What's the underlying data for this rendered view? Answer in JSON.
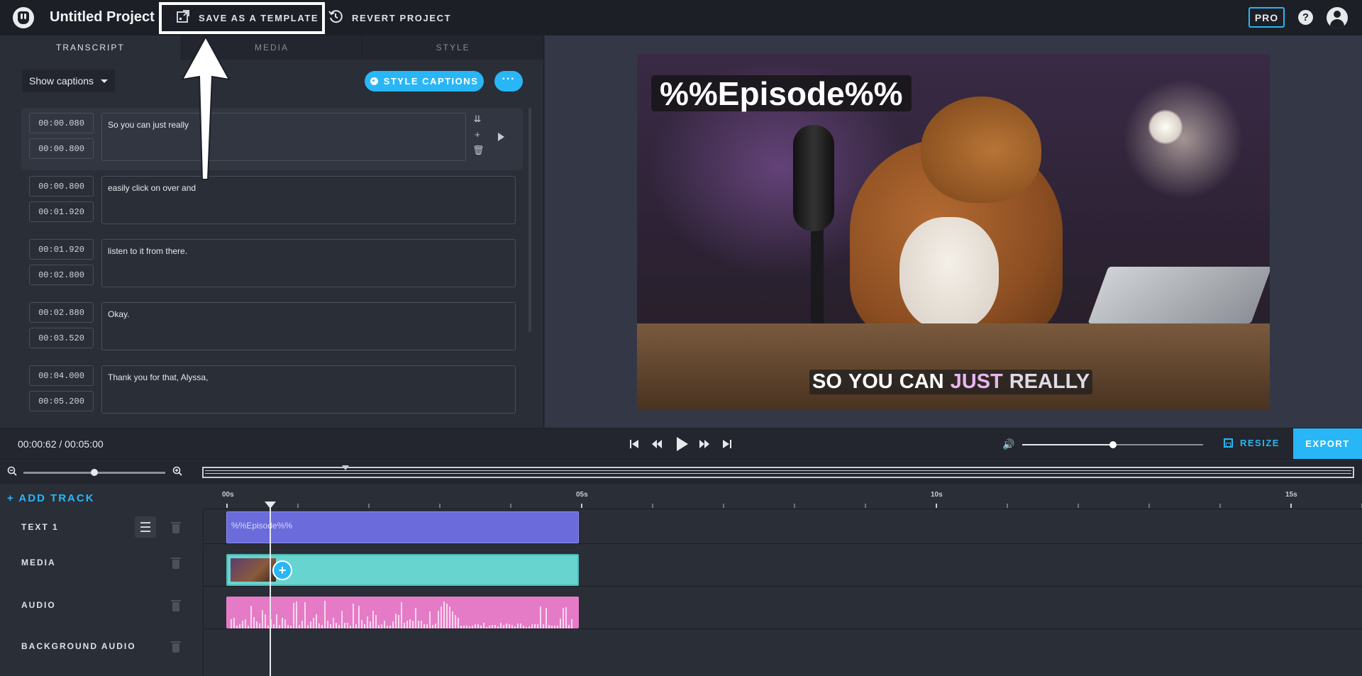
{
  "header": {
    "project_title": "Untitled Project",
    "save_template_label": "SAVE AS A TEMPLATE",
    "revert_label": "REVERT PROJECT",
    "pro_badge": "PRO",
    "help_glyph": "?"
  },
  "tabs": [
    "TRANSCRIPT",
    "MEDIA",
    "STYLE"
  ],
  "transcript": {
    "show_captions_label": "Show captions",
    "style_captions_label": "STYLE CAPTIONS",
    "more_glyph": "···",
    "rows": [
      {
        "start": "00:00.080",
        "end": "00:00.800",
        "text": "So you can just really"
      },
      {
        "start": "00:00.800",
        "end": "00:01.920",
        "text": "easily click on over and"
      },
      {
        "start": "00:01.920",
        "end": "00:02.800",
        "text": "listen to it from there."
      },
      {
        "start": "00:02.880",
        "end": "00:03.520",
        "text": "Okay."
      },
      {
        "start": "00:04.000",
        "end": "00:05.200",
        "text": "Thank you for that, Alyssa,"
      }
    ]
  },
  "preview": {
    "title_overlay": "%%Episode%%",
    "caption_words": [
      "SO",
      "YOU",
      "CAN",
      "JUST",
      "REALLY"
    ],
    "caption_highlight_word": "JUST",
    "caption_next_word": "REALLY"
  },
  "playback": {
    "timecode": "00:00:62 / 00:05:00",
    "volume_fraction": 0.5,
    "resize_label": "RESIZE",
    "export_label": "EXPORT"
  },
  "zoom": {
    "level_fraction": 0.5
  },
  "timeline": {
    "add_track_label": "+ ADD TRACK",
    "ruler_labels": [
      "00s",
      "05s",
      "10s",
      "15s"
    ],
    "tracks": [
      {
        "name": "TEXT 1",
        "clip_label": "%%Episode%%"
      },
      {
        "name": "MEDIA"
      },
      {
        "name": "AUDIO"
      },
      {
        "name": "BACKGROUND AUDIO"
      }
    ],
    "playhead_seconds": 0.62
  },
  "colors": {
    "accent": "#29b6f6",
    "text_clip": "#6b6bdb",
    "media_clip": "#68d4cf",
    "audio_clip": "#e57bc6",
    "caption_highlight": "#e9b6f0"
  }
}
